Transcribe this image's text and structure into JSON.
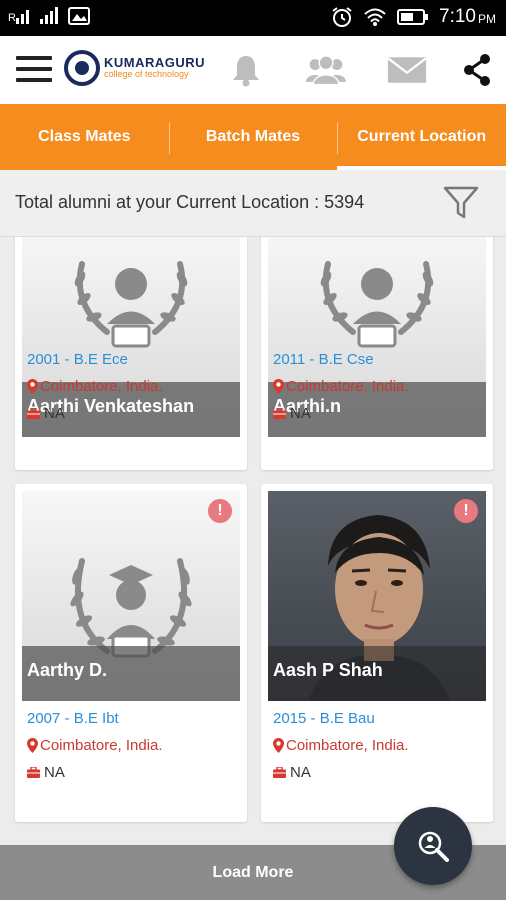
{
  "status_bar": {
    "time": "7:10",
    "ampm": "PM",
    "icons": [
      "sim-signal-icon",
      "signal-icon",
      "image-icon",
      "alarm-icon",
      "wifi-icon",
      "battery-icon"
    ]
  },
  "app_bar": {
    "logo_title": "KUMARAGURU",
    "logo_subtitle": "college of technology",
    "icons": [
      "menu-icon",
      "bell-icon",
      "group-icon",
      "mail-icon",
      "share-icon"
    ]
  },
  "tabs": [
    {
      "label": "Class Mates",
      "active": false
    },
    {
      "label": "Batch Mates",
      "active": false
    },
    {
      "label": "Current Location",
      "active": true
    }
  ],
  "summary": {
    "text": "Total alumni at your Current Location : 5394"
  },
  "alumni": [
    {
      "name": "Aarthi Venkateshan",
      "batch": "2001 - B.E Ece",
      "location": "Coimbatore, India.",
      "job": "NA",
      "photo": "placeholder"
    },
    {
      "name": "Aarthi.n",
      "batch": "2011 - B.E Cse",
      "location": "Coimbatore, India.",
      "job": "NA",
      "photo": "placeholder"
    },
    {
      "name": "Aarthy D.",
      "batch": "2007 - B.E Ibt",
      "location": "Coimbatore, India.",
      "job": "NA",
      "photo": "placeholder",
      "alert": "!"
    },
    {
      "name": "Aash P Shah",
      "batch": "2015 - B.E Bau",
      "location": "Coimbatore, India.",
      "job": "NA",
      "photo": "person",
      "alert": "!"
    }
  ],
  "load_more": "Load More",
  "colors": {
    "accent": "#f68b1e",
    "link": "#2a8fd6",
    "location": "#c9392f",
    "fab": "#2b3440"
  }
}
